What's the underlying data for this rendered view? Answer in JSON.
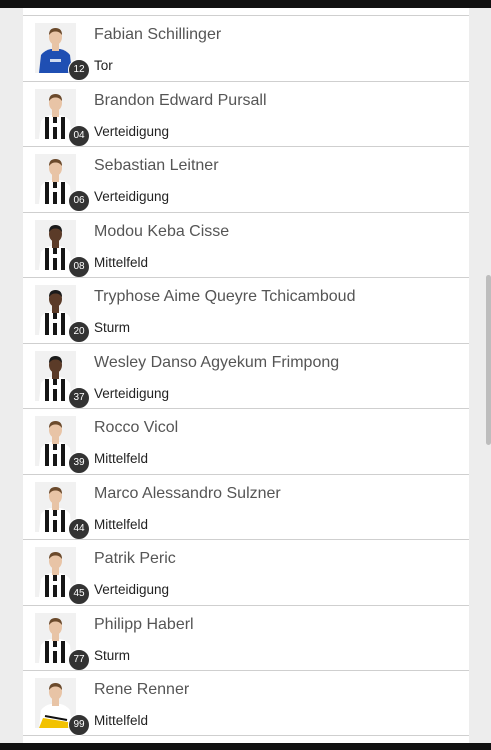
{
  "players": [
    {
      "number": "12",
      "name": "Fabian Schillinger",
      "position": "Tor",
      "kit": "keeper"
    },
    {
      "number": "04",
      "name": "Brandon Edward Pursall",
      "position": "Verteidigung",
      "kit": "stripes"
    },
    {
      "number": "06",
      "name": "Sebastian Leitner",
      "position": "Verteidigung",
      "kit": "stripes"
    },
    {
      "number": "08",
      "name": "Modou Keba Cisse",
      "position": "Mittelfeld",
      "kit": "stripes"
    },
    {
      "number": "20",
      "name": "Tryphose Aime Queyre Tchicamboud",
      "position": "Sturm",
      "kit": "stripes"
    },
    {
      "number": "37",
      "name": "Wesley Danso Agyekum Frimpong",
      "position": "Verteidigung",
      "kit": "stripes"
    },
    {
      "number": "39",
      "name": "Rocco Vicol",
      "position": "Mittelfeld",
      "kit": "stripes"
    },
    {
      "number": "44",
      "name": "Marco Alessandro Sulzner",
      "position": "Mittelfeld",
      "kit": "stripes"
    },
    {
      "number": "45",
      "name": "Patrik Peric",
      "position": "Verteidigung",
      "kit": "stripes"
    },
    {
      "number": "77",
      "name": "Philipp Haberl",
      "position": "Sturm",
      "kit": "stripes"
    },
    {
      "number": "99",
      "name": "Rene Renner",
      "position": "Mittelfeld",
      "kit": "away"
    }
  ],
  "colors": {
    "keeper_kit": "#1f4fb3",
    "stripe_dark": "#151515",
    "stripe_light": "#ffffff",
    "away_kit": "#f2c200",
    "skin_light": "#e8c4a6",
    "skin_dark": "#5b3b28",
    "badge": "#333333",
    "divider": "#cfcfcf"
  }
}
